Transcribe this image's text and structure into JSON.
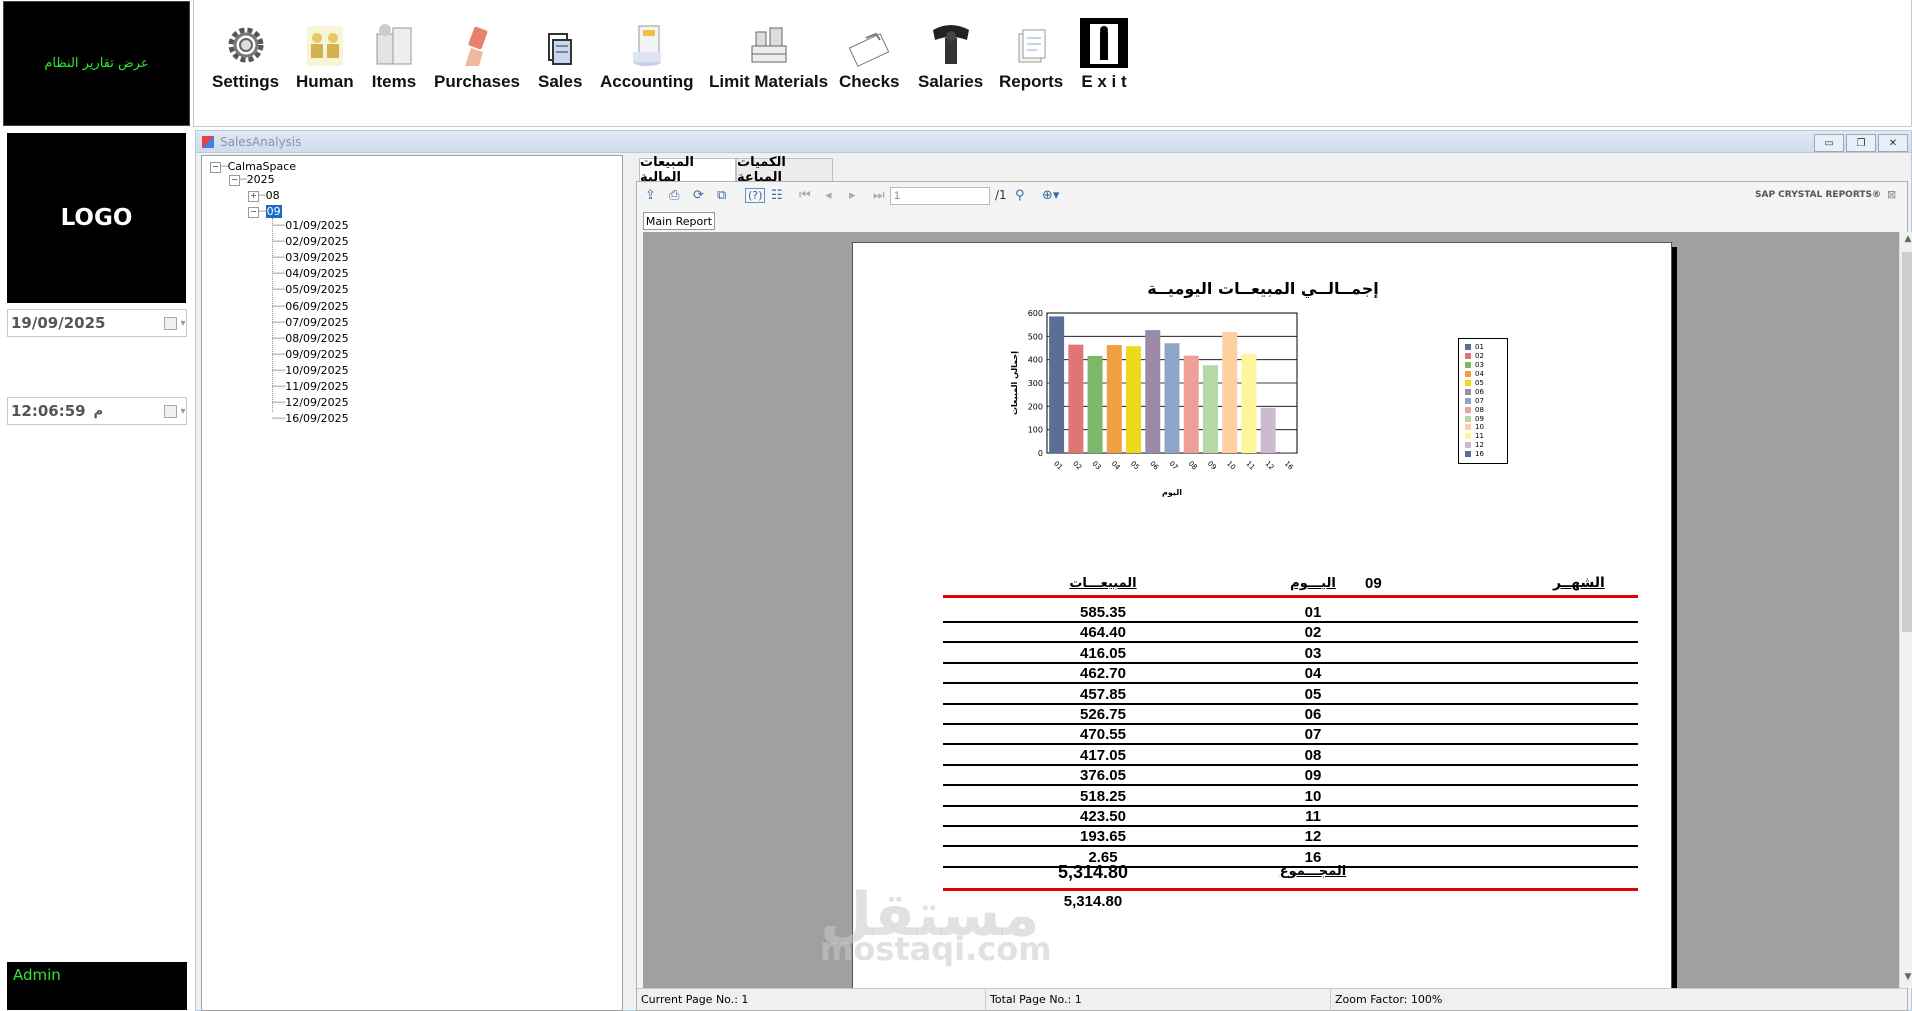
{
  "sidebar": {
    "system_reports_label": "عرض تقارير النظام",
    "logo_text": "LOGO",
    "date_value": "19/09/2025",
    "time_value": "12:06:59",
    "time_suffix": "م",
    "user": "Admin"
  },
  "toolbar": {
    "items": [
      {
        "label": "Settings",
        "icon": "gear-icon"
      },
      {
        "label": "Human",
        "icon": "people-icon"
      },
      {
        "label": "Items",
        "icon": "items-icon"
      },
      {
        "label": "Purchases",
        "icon": "purchases-icon"
      },
      {
        "label": "Sales",
        "icon": "sales-icon"
      },
      {
        "label": "Accounting",
        "icon": "accounting-icon"
      },
      {
        "label": "Limit Materials",
        "icon": "materials-icon"
      },
      {
        "label": "Checks",
        "icon": "checks-icon"
      },
      {
        "label": "Salaries",
        "icon": "salaries-icon"
      },
      {
        "label": "Reports",
        "icon": "reports-icon"
      },
      {
        "label": "E x i t",
        "icon": "exit-door-icon"
      }
    ]
  },
  "window": {
    "title": "SalesAnalysis",
    "controls": [
      "▭",
      "❐",
      "✕"
    ]
  },
  "tree": {
    "root": "CalmaSpace",
    "year": "2025",
    "months": [
      "08",
      "09"
    ],
    "selected_month": "09",
    "days": [
      "01/09/2025",
      "02/09/2025",
      "03/09/2025",
      "04/09/2025",
      "05/09/2025",
      "06/09/2025",
      "07/09/2025",
      "08/09/2025",
      "09/09/2025",
      "10/09/2025",
      "11/09/2025",
      "12/09/2025",
      "16/09/2025"
    ],
    "expand_symbols": {
      "collapsed": "+",
      "expanded": "−"
    }
  },
  "tabs": [
    {
      "label": "المبيعات المالية",
      "active": true
    },
    {
      "label": "الكميات المباعة",
      "active": false
    }
  ],
  "viewer": {
    "page_input": "1",
    "page_total": "/1",
    "brand": "SAP CRYSTAL REPORTS®",
    "main_report_tab": "Main Report",
    "status": {
      "current_page": "Current Page No.: 1",
      "total_page": "Total Page No.: 1",
      "zoom": "Zoom Factor: 100%"
    }
  },
  "report": {
    "title": "إجمــالــي المبيعــات اليوميــة",
    "month_label": "الشهــر",
    "month_value": "09",
    "day_header": "اليـــوم",
    "sales_header": "المبيعـــات",
    "rows": [
      {
        "day": "01",
        "value": "585.35"
      },
      {
        "day": "02",
        "value": "464.40"
      },
      {
        "day": "03",
        "value": "416.05"
      },
      {
        "day": "04",
        "value": "462.70"
      },
      {
        "day": "05",
        "value": "457.85"
      },
      {
        "day": "06",
        "value": "526.75"
      },
      {
        "day": "07",
        "value": "470.55"
      },
      {
        "day": "08",
        "value": "417.05"
      },
      {
        "day": "09",
        "value": "376.05"
      },
      {
        "day": "10",
        "value": "518.25"
      },
      {
        "day": "11",
        "value": "423.50"
      },
      {
        "day": "12",
        "value": "193.65"
      },
      {
        "day": "16",
        "value": "2.65"
      }
    ],
    "total_label": "المجـــموع",
    "total_value": "5,314.80",
    "cut_off_value": "5,314.80"
  },
  "chart_data": {
    "type": "bar",
    "title": "",
    "xlabel": "اليوم",
    "ylabel": "إجمالي المبيعات",
    "categories": [
      "01",
      "02",
      "03",
      "04",
      "05",
      "06",
      "07",
      "08",
      "09",
      "10",
      "11",
      "12",
      "16"
    ],
    "values": [
      585.35,
      464.4,
      416.05,
      462.7,
      457.85,
      526.75,
      470.55,
      417.05,
      376.05,
      518.25,
      423.5,
      193.65,
      2.65
    ],
    "colors": [
      "#5a6e96",
      "#e07575",
      "#7bb86a",
      "#f0a040",
      "#eed81c",
      "#9a8aa8",
      "#8fa6c8",
      "#eea098",
      "#b4d8a8",
      "#fdd0a0",
      "#fff59a",
      "#cabcce",
      "#5a6e96"
    ],
    "yticks": [
      "0",
      "100",
      "200",
      "300",
      "400",
      "500",
      "600"
    ],
    "ylim": [
      0,
      600
    ],
    "legend": "right",
    "grid": true
  },
  "watermark": {
    "arabic": "مستقل",
    "latin": "mostaqi.com"
  }
}
